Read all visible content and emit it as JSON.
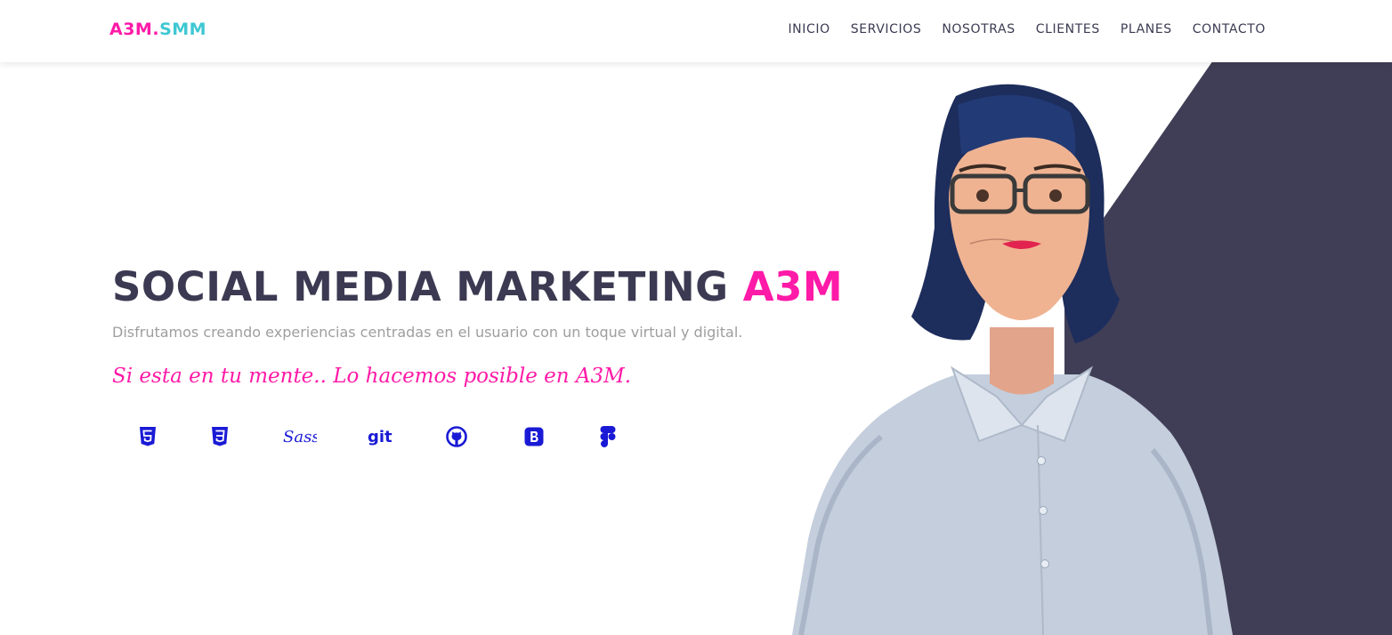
{
  "nav": {
    "brand_part1": "A3M.",
    "brand_part2": "SMM",
    "links": [
      "INICIO",
      "SERVICIOS",
      "NOSOTRAS",
      "CLIENTES",
      "PLANES",
      "CONTACTO"
    ]
  },
  "hero": {
    "title_main": "SOCIAL MEDIA MARKETING ",
    "title_accent": "A3M",
    "subtitle": "Disfrutamos creando experiencias centradas en el usuario con un toque virtual y digital.",
    "tagline": "Si esta en tu mente.. Lo hacemos posible en A3M.",
    "tech_sass_label": "Sass",
    "tech_git_label": "git"
  },
  "tech_icons": [
    "html5-icon",
    "css3-icon",
    "sass-icon",
    "git-icon",
    "github-icon",
    "bootstrap-icon",
    "figma-icon"
  ],
  "colors": {
    "accent_pink": "#ff1aa8",
    "accent_teal": "#3ec8d2",
    "dark_text": "#3b3a52",
    "diagonal_panel": "#403e56",
    "icon_blue": "#1a1ad6",
    "subtitle_grey": "#9e9e9e"
  }
}
